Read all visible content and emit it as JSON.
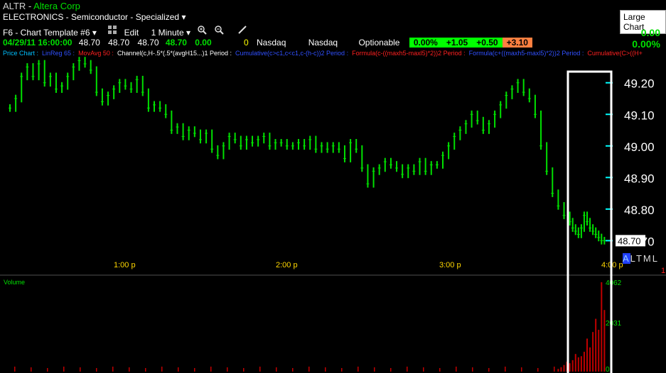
{
  "header": {
    "symbol": "ALTR",
    "company": "Altera Corp",
    "sector": "ELECTRONICS - Semiconductor - Specialized",
    "template": "F6 - Chart Template #6",
    "edit_label": "Edit",
    "interval": "1 Minute",
    "tooltip": "Large Chart"
  },
  "quote": {
    "datetime": "04/29/11 16:00:00",
    "open": "48.70",
    "high": "48.70",
    "low": "48.70",
    "last": "48.70",
    "change": "0.00",
    "volume": "0",
    "exchange1": "Nasdaq",
    "exchange2": "Nasdaq",
    "optionable": "Optionable",
    "pct": "0.00%",
    "b1": "+1.05",
    "b2": "+0.50",
    "b3": "+3.10",
    "right_change": "0.00",
    "right_pct": "0.00%"
  },
  "indicators": [
    {
      "label": "Price Chart",
      "color": "#00c0ff"
    },
    {
      "label": "LinReg 65",
      "color": "#3050ff"
    },
    {
      "label": "MovAvg 50",
      "color": "#ff2020"
    },
    {
      "label": "Channel(c,H-.5*(.5*(avgH15...)1 Period",
      "color": "#ffffff"
    },
    {
      "label": "Cumulative(c>c1,c<c1,c-(h-c))2 Period",
      "color": "#3050ff"
    },
    {
      "label": "Formula(c-((maxh5-maxl5)*2))2 Period",
      "color": "#ff2020"
    },
    {
      "label": "Formula(c+((maxh5-maxl5)*2))2 Period",
      "color": "#3050ff"
    },
    {
      "label": "Cumulative(C>((H+",
      "color": "#ff2020"
    }
  ],
  "price_axis": {
    "ticks": [
      "49.20",
      "49.10",
      "49.00",
      "48.90",
      "48.80",
      "48.70"
    ],
    "last_label": "48.70"
  },
  "time_axis": {
    "ticks": [
      "1:00 p",
      "2:00 p",
      "3:00 p",
      "4:00 p"
    ]
  },
  "scale_buttons": [
    "A",
    "L",
    "T",
    "M",
    "L"
  ],
  "volume": {
    "label": "Volume",
    "ticks": [
      "4062",
      "2031",
      "0"
    ],
    "marker": "1"
  },
  "colors": {
    "up": "#00e000",
    "volume_bar": "#c00000",
    "highlight": "#ffffff"
  },
  "chart_data": {
    "type": "line",
    "title": "ALTR - Altera Corp",
    "xlabel": "",
    "ylabel": "",
    "ylim": [
      48.62,
      49.26
    ],
    "x_ticks": [
      "1:00 p",
      "2:00 p",
      "3:00 p",
      "4:00 p"
    ],
    "series": [
      {
        "name": "Price",
        "t_minutes": [
          0,
          2,
          4,
          6,
          8,
          10,
          12,
          14,
          16,
          18,
          20,
          22,
          24,
          26,
          28,
          30,
          32,
          34,
          36,
          38,
          40,
          42,
          44,
          46,
          48,
          50,
          52,
          54,
          56,
          58,
          60,
          62,
          64,
          66,
          68,
          70,
          72,
          74,
          76,
          78,
          80,
          82,
          84,
          86,
          88,
          90,
          92,
          94,
          96,
          98,
          100,
          102,
          104,
          106,
          108,
          110,
          112,
          114,
          116,
          118,
          120,
          122,
          124,
          126,
          128,
          130,
          132,
          134,
          136,
          138,
          140,
          142,
          144,
          146,
          148,
          150,
          152,
          154,
          156,
          158,
          160,
          162,
          164,
          166,
          168,
          170,
          172,
          174,
          176,
          178,
          180,
          182,
          184,
          186,
          188,
          190,
          192,
          194,
          195,
          196,
          197,
          198,
          199,
          200,
          201,
          202,
          203,
          204,
          205,
          206
        ],
        "values": [
          49.12,
          49.15,
          49.22,
          49.25,
          49.22,
          49.26,
          49.2,
          49.22,
          49.18,
          49.19,
          49.22,
          49.25,
          49.27,
          49.26,
          49.24,
          49.17,
          49.14,
          49.16,
          49.18,
          49.2,
          49.19,
          49.18,
          49.21,
          49.17,
          49.12,
          49.13,
          49.12,
          49.1,
          49.05,
          49.06,
          49.03,
          49.05,
          49.04,
          49.02,
          49.04,
          48.99,
          48.97,
          49.0,
          49.03,
          49.02,
          49.0,
          49.02,
          49.01,
          49.02,
          49.03,
          49.0,
          49.01,
          49.01,
          49.0,
          49.0,
          49.01,
          49.0,
          49.02,
          48.99,
          49.0,
          48.99,
          49.0,
          48.99,
          48.96,
          49.01,
          48.99,
          48.93,
          48.88,
          48.92,
          48.93,
          48.95,
          48.94,
          48.93,
          48.91,
          48.93,
          48.92,
          48.95,
          48.92,
          48.94,
          48.94,
          48.97,
          49.0,
          49.03,
          49.05,
          49.07,
          49.1,
          49.08,
          49.05,
          49.07,
          49.1,
          49.13,
          49.16,
          49.18,
          49.2,
          49.17,
          49.15,
          49.1,
          49.0,
          48.92,
          48.85,
          48.81,
          48.78,
          48.76,
          48.74,
          48.73,
          48.72,
          48.74,
          48.78,
          48.76,
          48.74,
          48.73,
          48.72,
          48.71,
          48.7,
          48.7
        ]
      },
      {
        "name": "Volume",
        "t_minutes": [
          190,
          191,
          192,
          193,
          194,
          195,
          196,
          197,
          198,
          199,
          200,
          201,
          202,
          203,
          204,
          205,
          206
        ],
        "values": [
          120,
          200,
          300,
          450,
          380,
          520,
          800,
          650,
          700,
          900,
          1500,
          1100,
          1800,
          2400,
          1900,
          4062,
          2800
        ]
      }
    ]
  }
}
